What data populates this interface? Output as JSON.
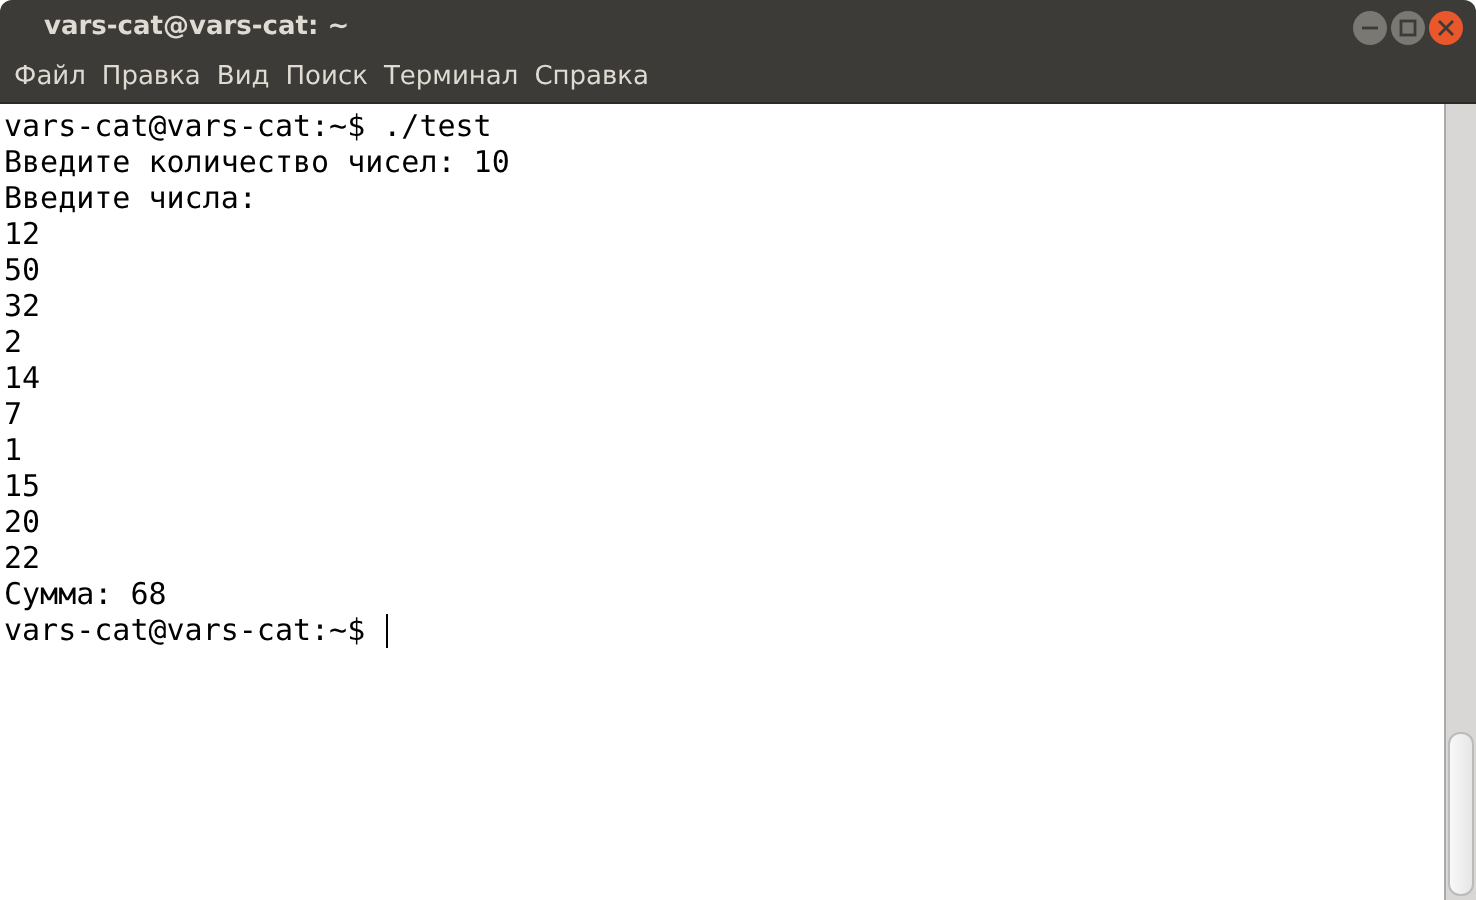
{
  "window": {
    "title": "vars-cat@vars-cat: ~"
  },
  "menu": [
    "Файл",
    "Правка",
    "Вид",
    "Поиск",
    "Терминал",
    "Справка"
  ],
  "terminal": {
    "lines": [
      "vars-cat@vars-cat:~$ ./test",
      "Введите количество чисел: 10",
      "Введите числа:",
      "12",
      "50",
      "32",
      "2",
      "14",
      "7",
      "1",
      "15",
      "20",
      "22",
      "Сумма: 68"
    ],
    "prompt": "vars-cat@vars-cat:~$"
  }
}
